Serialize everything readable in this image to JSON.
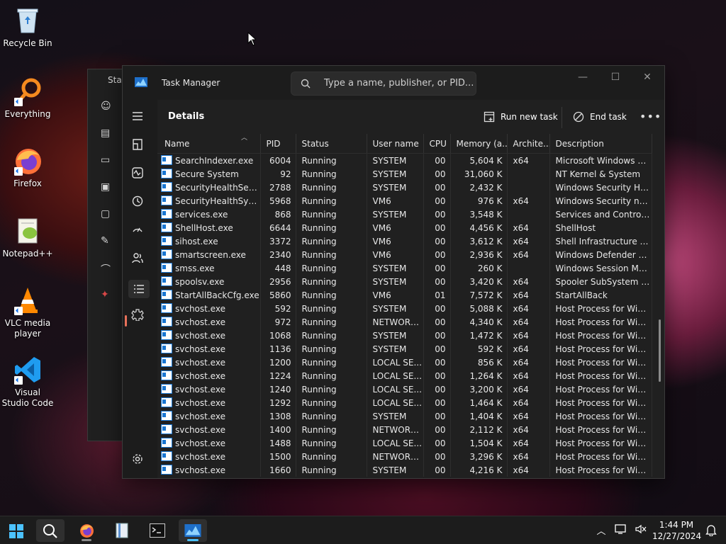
{
  "desktop": {
    "icons": [
      {
        "label": "Recycle Bin",
        "icon": "recycle-bin-icon"
      },
      {
        "label": "Everything",
        "icon": "everything-search-icon"
      },
      {
        "label": "Firefox",
        "icon": "firefox-icon"
      },
      {
        "label": "Notepad++",
        "icon": "notepad-plus-plus-icon"
      },
      {
        "label": "VLC media player",
        "icon": "vlc-icon"
      },
      {
        "label": "Visual Studio Code",
        "icon": "vscode-icon"
      }
    ]
  },
  "background_window": {
    "title_fragment": "Star"
  },
  "task_manager": {
    "title": "Task Manager",
    "search_placeholder": "Type a name, publisher, or PID...",
    "page_title": "Details",
    "run_new_task": "Run new task",
    "end_task": "End task",
    "more": "•••",
    "columns": [
      "Name",
      "PID",
      "Status",
      "User name",
      "CPU",
      "Memory (a...",
      "Archite...",
      "Description"
    ],
    "rows": [
      [
        "SearchIndexer.exe",
        "6004",
        "Running",
        "SYSTEM",
        "00",
        "5,604 K",
        "x64",
        "Microsoft Windows Se..."
      ],
      [
        "Secure System",
        "92",
        "Running",
        "SYSTEM",
        "00",
        "31,060 K",
        "",
        "NT Kernel & System"
      ],
      [
        "SecurityHealthServic...",
        "2788",
        "Running",
        "SYSTEM",
        "00",
        "2,432 K",
        "",
        "Windows Security Hea..."
      ],
      [
        "SecurityHealthSystra...",
        "5968",
        "Running",
        "VM6",
        "00",
        "976 K",
        "x64",
        "Windows Security noti..."
      ],
      [
        "services.exe",
        "868",
        "Running",
        "SYSTEM",
        "00",
        "3,548 K",
        "",
        "Services and Controlle..."
      ],
      [
        "ShellHost.exe",
        "6644",
        "Running",
        "VM6",
        "00",
        "4,456 K",
        "x64",
        "ShellHost"
      ],
      [
        "sihost.exe",
        "3372",
        "Running",
        "VM6",
        "00",
        "3,612 K",
        "x64",
        "Shell Infrastructure Host"
      ],
      [
        "smartscreen.exe",
        "2340",
        "Running",
        "VM6",
        "00",
        "2,936 K",
        "x64",
        "Windows Defender S..."
      ],
      [
        "smss.exe",
        "448",
        "Running",
        "SYSTEM",
        "00",
        "260 K",
        "",
        "Windows Session Man..."
      ],
      [
        "spoolsv.exe",
        "2956",
        "Running",
        "SYSTEM",
        "00",
        "3,420 K",
        "x64",
        "Spooler SubSystem App"
      ],
      [
        "StartAllBackCfg.exe",
        "5860",
        "Running",
        "VM6",
        "01",
        "7,572 K",
        "x64",
        "StartAllBack"
      ],
      [
        "svchost.exe",
        "592",
        "Running",
        "SYSTEM",
        "00",
        "5,088 K",
        "x64",
        "Host Process for Wind..."
      ],
      [
        "svchost.exe",
        "972",
        "Running",
        "NETWORK...",
        "00",
        "4,340 K",
        "x64",
        "Host Process for Wind..."
      ],
      [
        "svchost.exe",
        "1068",
        "Running",
        "SYSTEM",
        "00",
        "1,472 K",
        "x64",
        "Host Process for Wind..."
      ],
      [
        "svchost.exe",
        "1136",
        "Running",
        "SYSTEM",
        "00",
        "592 K",
        "x64",
        "Host Process for Wind..."
      ],
      [
        "svchost.exe",
        "1200",
        "Running",
        "LOCAL SE...",
        "00",
        "856 K",
        "x64",
        "Host Process for Wind..."
      ],
      [
        "svchost.exe",
        "1224",
        "Running",
        "LOCAL SE...",
        "00",
        "1,264 K",
        "x64",
        "Host Process for Wind..."
      ],
      [
        "svchost.exe",
        "1240",
        "Running",
        "LOCAL SE...",
        "00",
        "3,200 K",
        "x64",
        "Host Process for Wind..."
      ],
      [
        "svchost.exe",
        "1292",
        "Running",
        "LOCAL SE...",
        "00",
        "1,464 K",
        "x64",
        "Host Process for Wind..."
      ],
      [
        "svchost.exe",
        "1308",
        "Running",
        "SYSTEM",
        "00",
        "1,404 K",
        "x64",
        "Host Process for Wind..."
      ],
      [
        "svchost.exe",
        "1400",
        "Running",
        "NETWORK...",
        "00",
        "2,112 K",
        "x64",
        "Host Process for Wind..."
      ],
      [
        "svchost.exe",
        "1488",
        "Running",
        "LOCAL SE...",
        "00",
        "1,504 K",
        "x64",
        "Host Process for Wind..."
      ],
      [
        "svchost.exe",
        "1500",
        "Running",
        "NETWORK...",
        "00",
        "3,296 K",
        "x64",
        "Host Process for Wind..."
      ],
      [
        "svchost.exe",
        "1660",
        "Running",
        "SYSTEM",
        "00",
        "4,216 K",
        "x64",
        "Host Process for Wind..."
      ]
    ]
  },
  "taskbar": {
    "time": "1:44 PM",
    "date": "12/27/2024"
  },
  "colors": {
    "accent": "#e8715a",
    "window_bg": "#202020",
    "taskbar_bg": "#1c1c1c"
  }
}
